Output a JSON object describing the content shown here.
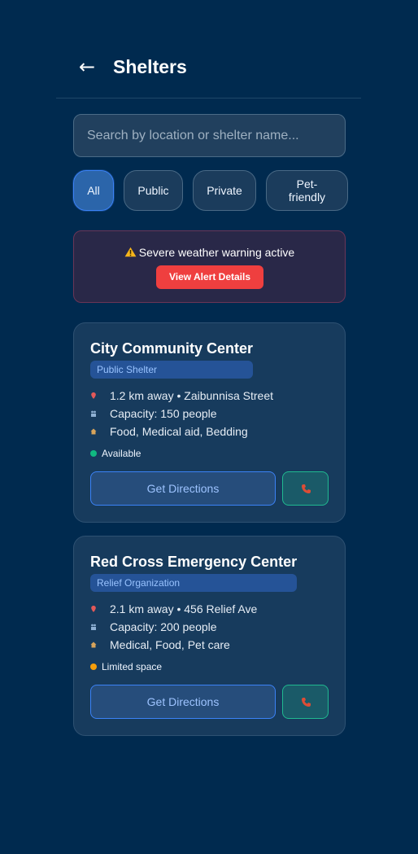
{
  "header": {
    "back_icon": "←",
    "title": "Shelters"
  },
  "search": {
    "placeholder": "Search by location or shelter name...",
    "value": ""
  },
  "filters": [
    {
      "label": "All",
      "active": true
    },
    {
      "label": "Public",
      "active": false
    },
    {
      "label": "Private",
      "active": false
    },
    {
      "label": "Pet-\nfriendly",
      "active": false
    }
  ],
  "alert": {
    "icon": "warning-icon",
    "text": "Severe weather warning active",
    "button_label": "View Alert Details"
  },
  "shelters": [
    {
      "name": "City Community Center",
      "tag": "Public Shelter",
      "distance_address": "1.2 km away • Zaibunnisa Street",
      "capacity": "Capacity: 150 people",
      "amenities": "Food, Medical aid, Bedding",
      "status": "Available",
      "status_color": "#10b981",
      "directions_label": "Get Directions"
    },
    {
      "name": "Red Cross Emergency Center",
      "tag": "Relief Organization",
      "distance_address": "2.1 km away • 456 Relief Ave",
      "capacity": "Capacity: 200 people",
      "amenities": "Medical, Food, Pet care",
      "status": "Limited space",
      "status_color": "#f59e0b",
      "directions_label": "Get Directions"
    }
  ],
  "colors": {
    "background": "#002a4f",
    "card": "#173b5d",
    "accent_blue": "#3b82f6",
    "alert_red": "#ef3f3f",
    "available_green": "#10b981",
    "limited_amber": "#f59e0b"
  }
}
